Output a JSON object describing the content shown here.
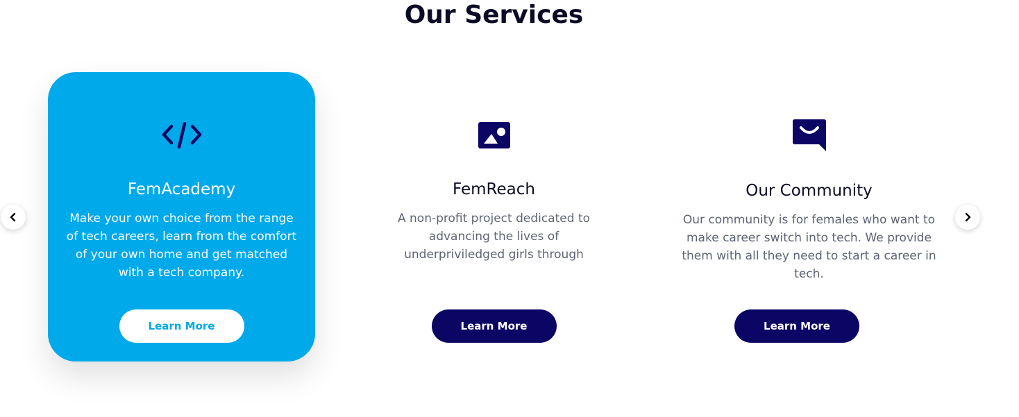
{
  "section": {
    "title": "Our Services"
  },
  "colors": {
    "accent": "#00a9ea",
    "navy": "#0b0664",
    "text_dark": "#0b0b25",
    "text_muted": "#5e6473"
  },
  "cards": [
    {
      "icon": "code-icon",
      "title": "FemAcademy",
      "description": "Make your own choice from the range of tech careers, learn from the comfort of your own home and get matched with a tech company.",
      "button_label": "Learn More",
      "active": true
    },
    {
      "icon": "image-icon",
      "title": "FemReach",
      "description": "A non-profit project dedicated to advancing the lives of underpriviledged girls through",
      "button_label": "Learn More",
      "active": false
    },
    {
      "icon": "chat-smile-icon",
      "title": "Our Community",
      "description": "Our community is for females who want to make career switch into tech. We provide them with all they need to start a career in tech.",
      "button_label": "Learn More",
      "active": false
    }
  ],
  "navigation": {
    "prev_icon": "chevron-left-icon",
    "next_icon": "chevron-right-icon"
  }
}
